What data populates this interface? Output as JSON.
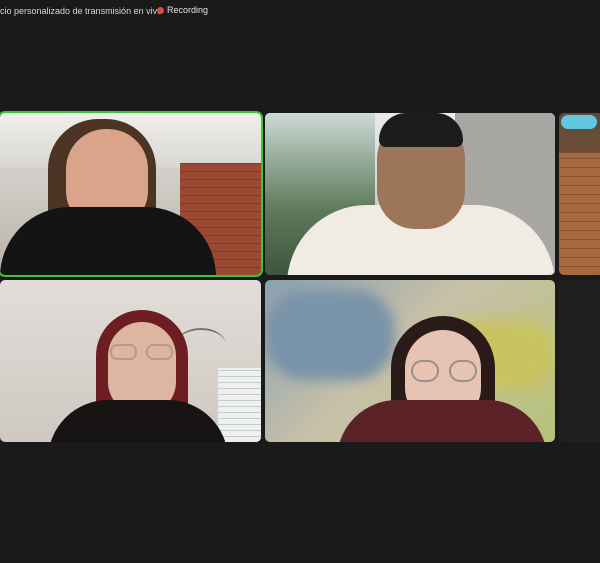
{
  "meeting": {
    "banner_text": "icio personalizado de transmisión en vivo",
    "recording_label": "Recording",
    "recording_color": "#e5483e",
    "active_speaker_color": "#3cc43a"
  },
  "participants": [
    {
      "tile": "participant-tile-1",
      "active_speaker": true
    },
    {
      "tile": "participant-tile-2",
      "active_speaker": false
    },
    {
      "tile": "participant-tile-3",
      "active_speaker": false
    },
    {
      "tile": "participant-tile-4",
      "active_speaker": false
    },
    {
      "tile": "participant-tile-5",
      "active_speaker": false,
      "background": "blurred"
    },
    {
      "tile": "participant-tile-6",
      "active_speaker": false
    }
  ]
}
